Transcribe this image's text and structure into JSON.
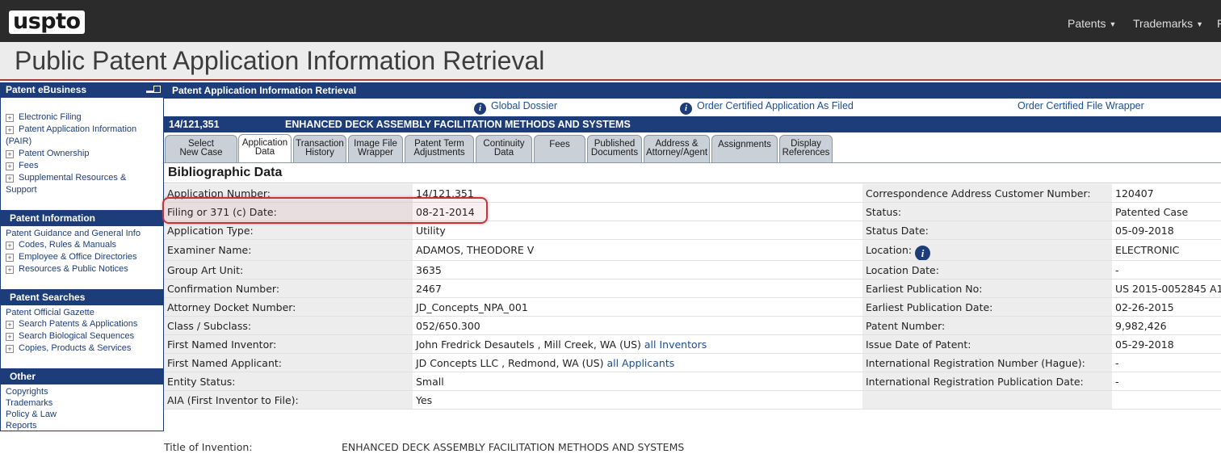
{
  "header": {
    "logo": "uspto",
    "nav": [
      "Patents",
      "Trademarks",
      "F"
    ]
  },
  "page_title": "Public Patent Application Information Retrieval",
  "sidebar": {
    "ebusiness": {
      "title": "Patent eBusiness",
      "items": [
        "Electronic Filing",
        "Patent Application Information",
        "(PAIR)",
        "Patent Ownership",
        "Fees",
        "Supplemental Resources &",
        "Support"
      ]
    },
    "information": {
      "title": "Patent Information",
      "items": [
        "Patent Guidance and General Info",
        "Codes, Rules & Manuals",
        "Employee & Office Directories",
        "Resources & Public Notices"
      ]
    },
    "searches": {
      "title": "Patent Searches",
      "items": [
        "Patent Official Gazette",
        "Search Patents & Applications",
        "Search Biological Sequences",
        "Copies, Products & Services"
      ]
    },
    "other": {
      "title": "Other",
      "items": [
        "Copyrights",
        "Trademarks",
        "Policy & Law",
        "Reports"
      ]
    }
  },
  "main": {
    "header": "Patent Application Information Retrieval",
    "links": [
      "Global Dossier",
      "Order Certified Application As Filed",
      "Order Certified File Wrapper"
    ],
    "case_number": "14/121,351",
    "case_title": "ENHANCED DECK ASSEMBLY FACILITATION METHODS AND SYSTEMS",
    "tabs": [
      [
        "Select",
        "New Case"
      ],
      [
        "Application",
        "Data"
      ],
      [
        "Transaction",
        "History"
      ],
      [
        "Image File",
        "Wrapper"
      ],
      [
        "Patent Term",
        "Adjustments"
      ],
      [
        "Continuity",
        "Data"
      ],
      [
        "Fees",
        ""
      ],
      [
        "Published",
        "Documents"
      ],
      [
        "Address &",
        "Attorney/Agent"
      ],
      [
        "Assignments",
        ""
      ],
      [
        "Display",
        "References"
      ]
    ],
    "section_title": "Bibliographic Data",
    "rows": [
      [
        "Application Number:",
        "14/121,351",
        "Correspondence Address Customer Number:",
        "120407"
      ],
      [
        "Filing or 371 (c) Date:",
        "08-21-2014",
        "Status:",
        "Patented Case"
      ],
      [
        "Application Type:",
        "Utility",
        "Status Date:",
        "05-09-2018"
      ],
      [
        "Examiner Name:",
        "ADAMOS, THEODORE V",
        "Location:",
        "ELECTRONIC"
      ],
      [
        "Group Art Unit:",
        "3635",
        "Location Date:",
        "-"
      ],
      [
        "Confirmation Number:",
        "2467",
        "Earliest Publication No:",
        "US 2015-0052845 A1"
      ],
      [
        "Attorney Docket Number:",
        "JD_Concepts_NPA_001",
        "Earliest Publication Date:",
        "02-26-2015"
      ],
      [
        "Class / Subclass:",
        "052/650.300",
        "Patent Number:",
        "9,982,426"
      ],
      [
        "First Named Inventor:",
        "John Fredrick Desautels , Mill Creek, WA (US)",
        "Issue Date of Patent:",
        "05-29-2018"
      ],
      [
        "First Named Applicant:",
        "JD Concepts LLC , Redmond, WA (US)",
        "International Registration Number (Hague):",
        "-"
      ],
      [
        "Entity Status:",
        "Small",
        "International Registration Publication Date:",
        "-"
      ],
      [
        "AIA (First Inventor to File):",
        "Yes",
        "",
        ""
      ]
    ],
    "inventor_link": "all Inventors",
    "applicant_link": "all Applicants",
    "title_label": "Title of Invention:",
    "title_value": "ENHANCED DECK ASSEMBLY FACILITATION METHODS AND SYSTEMS"
  },
  "colors": {
    "navy": "#1d3d7a",
    "highlight": "#c0363d",
    "topbar": "#2b2b2b"
  }
}
